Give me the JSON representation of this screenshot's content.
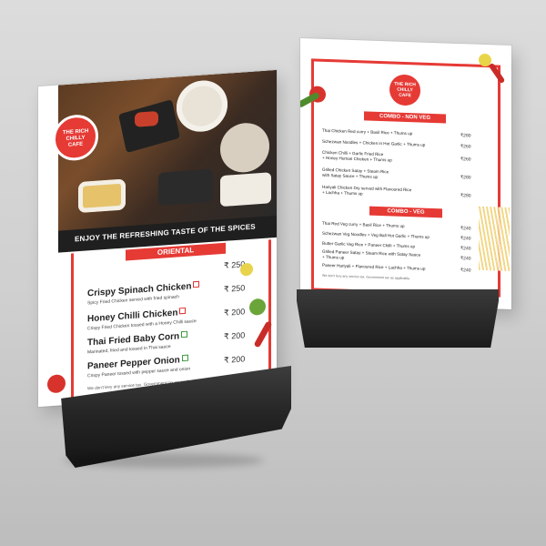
{
  "brand": {
    "name_top": "THE RICH CHILLY",
    "name_bottom": "CAFE"
  },
  "left_menu": {
    "tagline": "ENJOY THE REFRESHING TASTE OF THE SPICES",
    "section": "ORIENTAL",
    "items": [
      {
        "name": "Crispy Spinach Chicken",
        "desc": "Spicy Fried Chicken served with fried spinach",
        "price": "₹ 250"
      },
      {
        "name": "Honey Chilli Chicken",
        "desc": "Crispy Fried Chicken tossed with a Honey Chilli sauce",
        "price": "₹ 200"
      },
      {
        "name": "Thai Fried Baby Corn",
        "desc": "Marinated, fried and tossed in Thai sauce",
        "price": "₹ 200"
      },
      {
        "name": "Paneer Pepper Onion",
        "desc": "Crispy Paneer tossed with pepper sauce and onion",
        "price": "₹ 200"
      }
    ],
    "first_price": "₹ 250",
    "footer": "We don't levy any service tax. Government tax as applicable."
  },
  "right_menu": {
    "section_nonveg": "COMBO - NON VEG",
    "nonveg": [
      {
        "line1": "Thai Chicken Red curry + Basil Rice + Thums up",
        "line2": "",
        "price": "₹280"
      },
      {
        "line1": "Schezwan Noodles + Chicken in Hot Garlic + Thums up",
        "line2": "",
        "price": "₹260"
      },
      {
        "line1": "Chicken Chilli + Garlic Fried Rice",
        "line2": "+ Honey Human Chicken + Thums up",
        "price": "₹260"
      },
      {
        "line1": "Grilled Chicken Satay + Steam Rice",
        "line2": "with Satay Sauce + Thums up",
        "price": "₹280"
      },
      {
        "line1": "Hariyali Chicken Dry served with Flavoured Rice",
        "line2": "+ Lachha + Thums up",
        "price": "₹280"
      }
    ],
    "section_veg": "COMBO - VEG",
    "veg": [
      {
        "line1": "Thai Red Veg curry + Basil Rice + Thums up",
        "line2": "",
        "price": "₹240"
      },
      {
        "line1": "Schezwan Veg Noodles + Veg Ball Hot Garlic + Thums up",
        "line2": "",
        "price": "₹240"
      },
      {
        "line1": "Butter Garlic Veg Rice + Paneer Chilli + Thums up",
        "line2": "",
        "price": "₹240"
      },
      {
        "line1": "Grilled Paneer Satay + Steam Rice with Satay Sauce",
        "line2": "+ Thums up",
        "price": "₹240"
      },
      {
        "line1": "Paneer Hariyali + Flavoured Rice + Lachha + Thums up",
        "line2": "",
        "price": "₹240"
      }
    ],
    "footer": "We don't levy any service tax. Government tax as applicable."
  },
  "colors": {
    "accent": "#e63a35",
    "stand": "#2b2b2b",
    "background": "#d2d2d2"
  }
}
